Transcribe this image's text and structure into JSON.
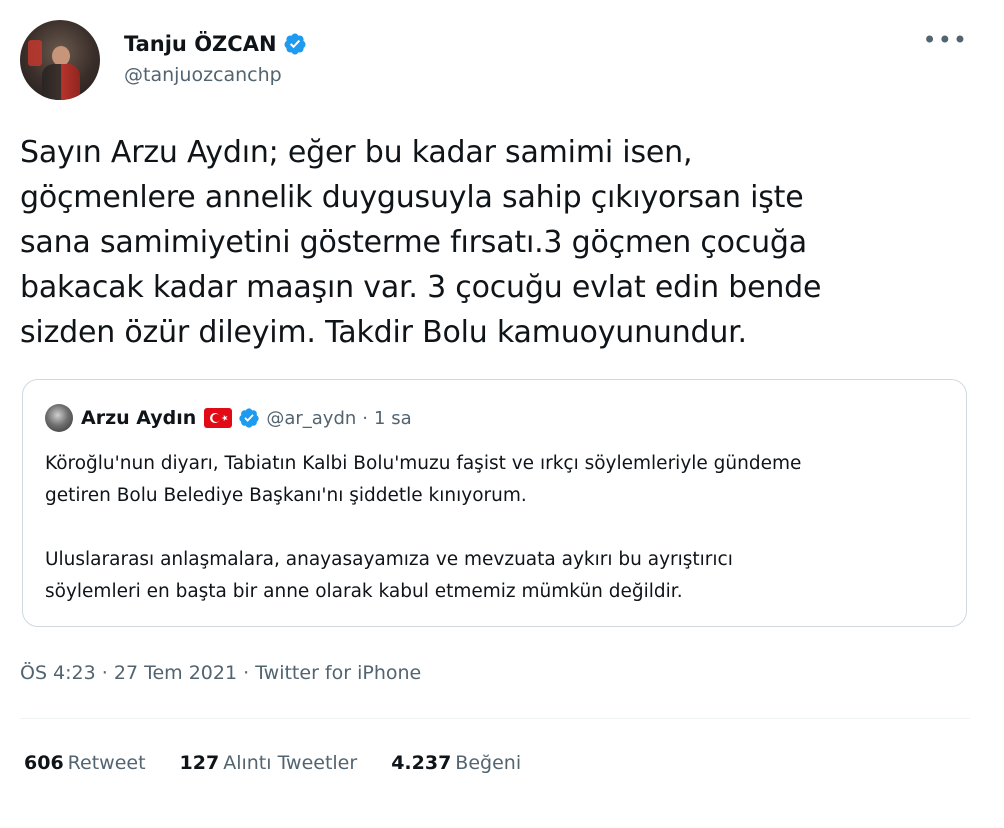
{
  "author": {
    "display_name": "Tanju ÖZCAN",
    "handle": "@tanjuozcanchp",
    "verified": true,
    "more_icon": "more-horizontal-icon"
  },
  "tweet": {
    "lines": [
      "Sayın Arzu Aydın; eğer bu kadar samimi isen,",
      "göçmenlere annelik duygusuyla sahip çıkıyorsan işte",
      "sana samimiyetini gösterme fırsatı.3 göçmen çocuğa",
      "bakacak kadar maaşın var. 3 çocuğu evlat edin bende",
      "sizden özür dileyim. Takdir Bolu kamuoyunundur."
    ]
  },
  "quoted": {
    "display_name": "Arzu Aydın",
    "flag": "turkey-flag-emoji",
    "verified": true,
    "handle": "@ar_aydn",
    "separator": "·",
    "time_ago": "1 sa",
    "paragraph1": [
      "Köroğlu'nun diyarı, Tabiatın Kalbi Bolu'muzu faşist ve ırkçı söylemleriyle gündeme",
      "getiren Bolu Belediye Başkanı'nı şiddetle kınıyorum."
    ],
    "paragraph2": [
      "Uluslararası anlaşmalara, anayasayamıza ve mevzuata aykırı bu ayrıştırıcı",
      "söylemleri en başta bir anne olarak kabul etmemiz mümkün değildir."
    ]
  },
  "meta": {
    "time": "ÖS 4:23",
    "sep1": "·",
    "date": "27 Tem 2021",
    "sep2": "·",
    "source": "Twitter for iPhone"
  },
  "stats": {
    "retweets": {
      "count": "606",
      "label": "Retweet"
    },
    "quotes": {
      "count": "127",
      "label": "Alıntı Tweetler"
    },
    "likes": {
      "count": "4.237",
      "label": "Beğeni"
    }
  },
  "colors": {
    "text": "#0f1419",
    "secondary": "#536471",
    "verified_blue": "#1d9bf0",
    "border": "#cfd9de"
  }
}
